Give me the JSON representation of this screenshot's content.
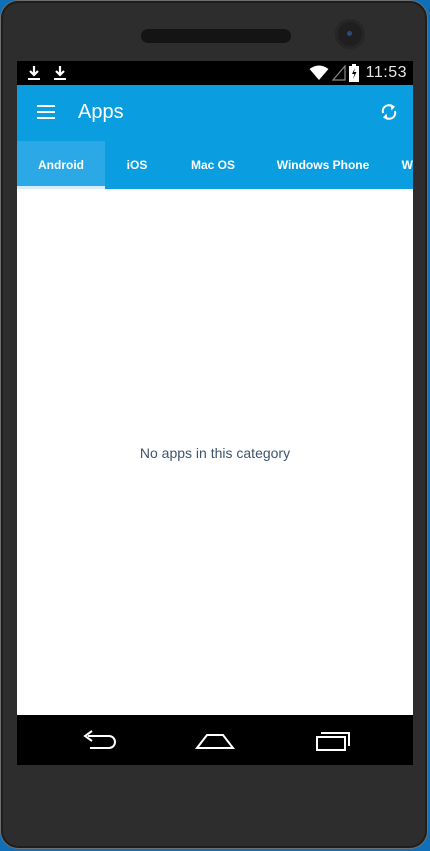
{
  "status_bar": {
    "left_icons": [
      "download-icon",
      "download-icon"
    ],
    "right_icons": [
      "wifi-icon",
      "signal-icon",
      "battery-icon"
    ],
    "time": "11:53"
  },
  "app_bar": {
    "menu_icon": "menu-icon",
    "title": "Apps",
    "refresh_icon": "refresh-icon"
  },
  "tabs": [
    {
      "label": "Android",
      "active": true
    },
    {
      "label": "iOS",
      "active": false
    },
    {
      "label": "Mac OS",
      "active": false
    },
    {
      "label": "Windows Phone",
      "active": false
    },
    {
      "label": "W",
      "active": false
    }
  ],
  "content": {
    "empty_message": "No apps in this category"
  },
  "nav_bar": {
    "buttons": [
      "back-icon",
      "home-icon",
      "recents-icon"
    ]
  },
  "colors": {
    "app_bar": "#0a9de0",
    "active_tab": "#2ba9e6",
    "empty_text": "#3f546d"
  }
}
